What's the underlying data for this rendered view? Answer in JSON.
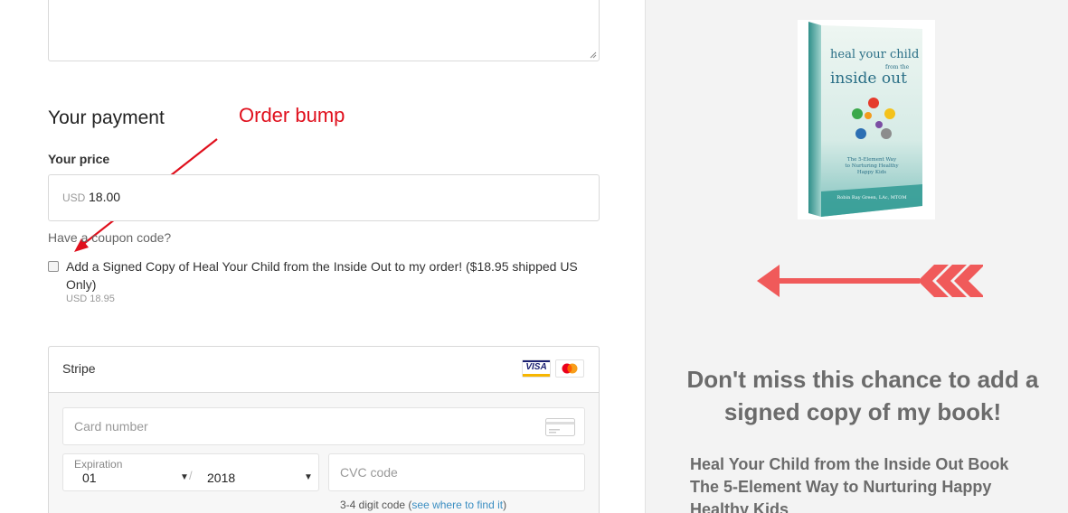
{
  "payment": {
    "section_title": "Your payment",
    "price_label": "Your price",
    "currency": "USD",
    "price": "18.00",
    "coupon_link": "Have a coupon code?"
  },
  "annotation": {
    "label": "Order bump",
    "color": "#e0101d"
  },
  "order_bump": {
    "checked": false,
    "text": "Add a Signed Copy of Heal Your Child from the Inside Out to my order! ($18.95 shipped US Only)",
    "price_text": "USD 18.95"
  },
  "stripe": {
    "name": "Stripe",
    "card_brands": [
      "Visa",
      "Mastercard"
    ],
    "visa_text": "VISA",
    "card_number_placeholder": "Card number",
    "expiration_label": "Expiration",
    "expiration_month": "01",
    "expiration_year": "2018",
    "separator": "/",
    "cvc_placeholder": "CVC code",
    "cvc_hint_prefix": "3-4 digit code (",
    "cvc_hint_link": "see where to find it",
    "cvc_hint_suffix": ")"
  },
  "promo": {
    "book_title_line1": "heal your child",
    "book_title_small": "from the",
    "book_title_line2": "inside out",
    "book_subtitle_1": "The 5-Element Way",
    "book_subtitle_2": "to Nurturing Healthy",
    "book_subtitle_3": "Happy Kids",
    "book_author": "Robin Ray Green, LAc, MTOM",
    "headline": "Don't miss this chance to add a signed copy of my book!",
    "sub_line1": "Heal Your Child from the Inside Out Book",
    "sub_line2": "The 5-Element Way to Nurturing Happy",
    "sub_line3": "Healthy Kids",
    "arrow_color": "#f05a5a"
  }
}
